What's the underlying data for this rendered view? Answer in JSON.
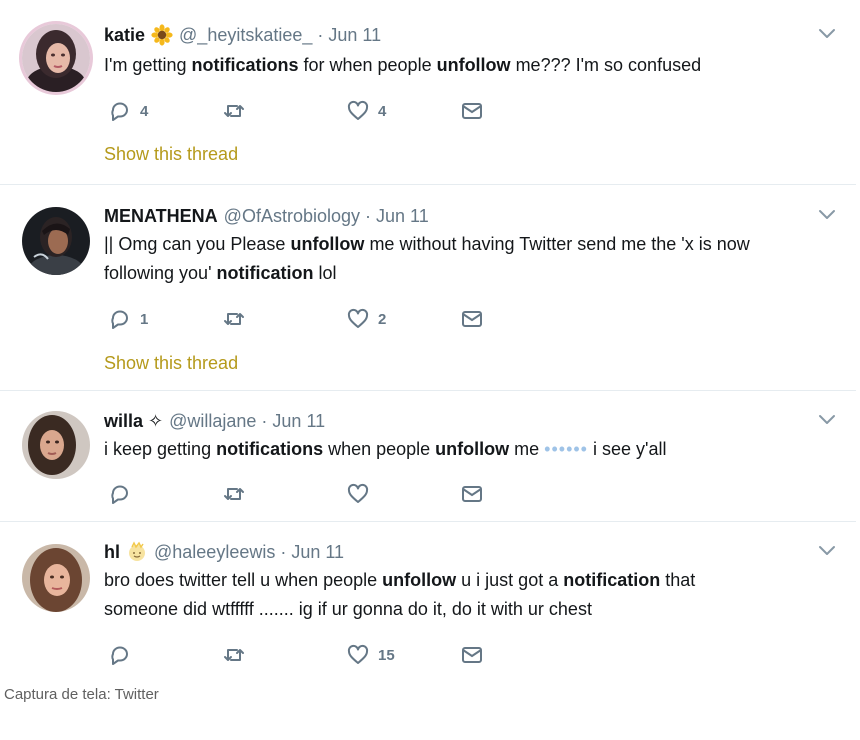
{
  "tweets": [
    {
      "name": "katie",
      "emoji_icon": "sunflower-icon",
      "handle": "@_heyitskatiee_",
      "dot": "·",
      "date": "Jun 11",
      "text_parts": [
        "I'm getting ",
        "notifications",
        " for when people ",
        "unfollow",
        " me??? I'm so confused"
      ],
      "replies": "4",
      "retweets": "",
      "likes": "4",
      "thread_link": "Show this thread"
    },
    {
      "name": "MENATHENA",
      "handle": "@OfAstrobiology",
      "dot": "·",
      "date": "Jun 11",
      "text_parts": [
        "|| Omg can you Please ",
        "unfollow",
        " me without having Twitter send me the 'x is now",
        "following you' ",
        "notification",
        " lol"
      ],
      "replies": "1",
      "retweets": "",
      "likes": "2",
      "thread_link": "Show this thread"
    },
    {
      "name": "willa",
      "name_symbol": "✧",
      "handle": "@willajane",
      "dot": "·",
      "date": "Jun 11",
      "text_parts": [
        "i keep getting ",
        "notifications",
        " when people ",
        "unfollow",
        " me ",
        "••••••",
        " i see y'all"
      ],
      "replies": "",
      "retweets": "",
      "likes": ""
    },
    {
      "name": "hl",
      "emoji_icon": "sparkle-face-icon",
      "handle": "@haleeyleewis",
      "dot": "·",
      "date": "Jun 11",
      "text_parts": [
        "bro does twitter tell u when people ",
        "unfollow",
        " u i just got a ",
        "notification",
        " that",
        "someone did wtfffff ....... ig if ur gonna do it, do it with ur chest"
      ],
      "replies": "",
      "retweets": "",
      "likes": "15"
    }
  ],
  "caption": "Captura de tela: Twitter",
  "colors": {
    "link": "#b59a1c",
    "muted": "#657786",
    "divider": "#e6ecf0",
    "dots": "#9fc3e7"
  }
}
